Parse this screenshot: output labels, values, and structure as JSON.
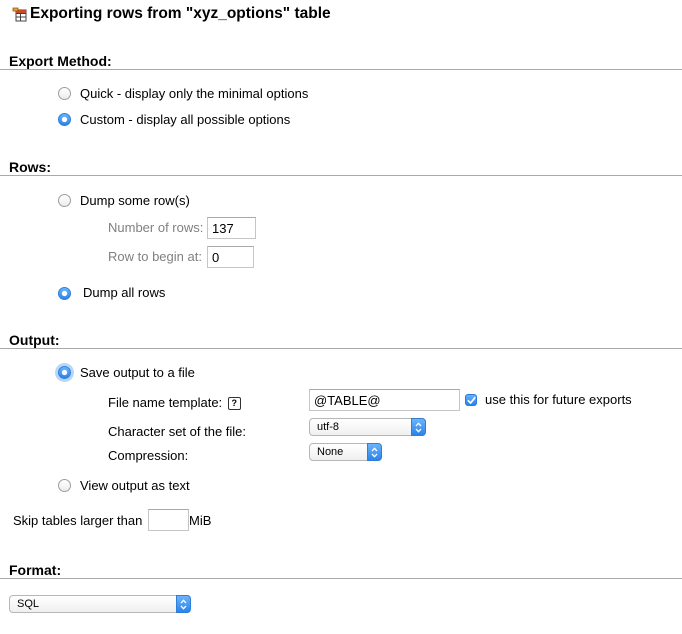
{
  "header": {
    "title": "Exporting rows from \"xyz_options\" table",
    "icon": "export-table-icon"
  },
  "export_method": {
    "heading": "Export Method:",
    "options": [
      {
        "label": "Quick - display only the minimal options",
        "selected": false
      },
      {
        "label": "Custom - display all possible options",
        "selected": true
      }
    ]
  },
  "rows": {
    "heading": "Rows:",
    "dump_some_label": "Dump some row(s)",
    "number_of_rows_label": "Number of rows:",
    "number_of_rows_value": "137",
    "row_to_begin_label": "Row to begin at:",
    "row_to_begin_value": "0",
    "dump_all_label": "Dump all rows",
    "dump_all_selected": true
  },
  "output": {
    "heading": "Output:",
    "save_to_file_label": "Save output to a file",
    "file_name_template_label": "File name template:",
    "help_icon_glyph": "?",
    "file_name_template_value": "@TABLE@",
    "use_for_future_label": "use this for future exports",
    "use_for_future_checked": true,
    "charset_label": "Character set of the file:",
    "charset_value": "utf-8",
    "compression_label": "Compression:",
    "compression_value": "None",
    "view_as_text_label": "View output as text",
    "skip_tables_label": "Skip tables larger than",
    "skip_tables_value": "",
    "skip_tables_unit": "MiB"
  },
  "format": {
    "heading": "Format:",
    "value": "SQL"
  },
  "colors": {
    "accent": "#2a84ea",
    "rule": "#a9a9a9",
    "dim_text": "#808080"
  }
}
